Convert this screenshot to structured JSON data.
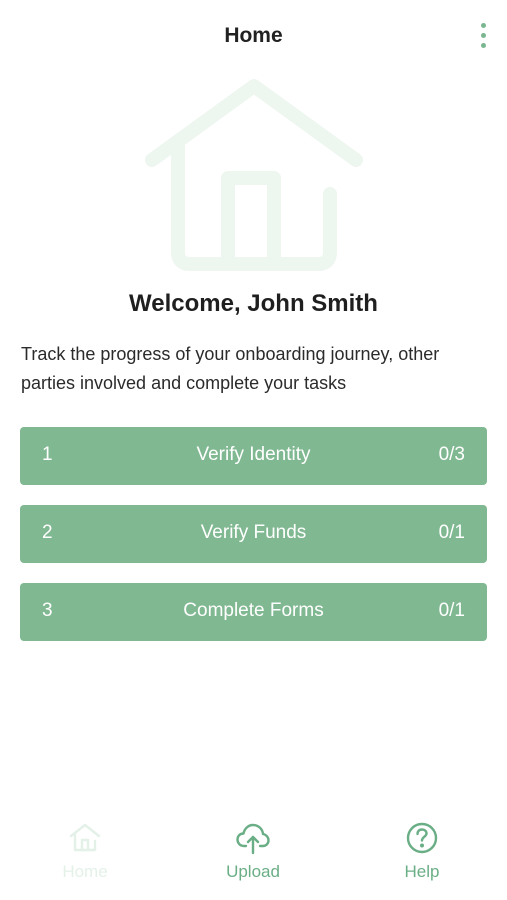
{
  "header": {
    "title": "Home",
    "menu_icon": "more-vert-icon"
  },
  "hero": {
    "icon": "house-icon"
  },
  "welcome": {
    "title": "Welcome, John Smith",
    "description": "Track the progress of your onboarding journey, other parties involved and complete your tasks"
  },
  "tasks": [
    {
      "number": "1",
      "label": "Verify Identity",
      "progress": "0/3"
    },
    {
      "number": "2",
      "label": "Verify Funds",
      "progress": "0/1"
    },
    {
      "number": "3",
      "label": "Complete Forms",
      "progress": "0/1"
    }
  ],
  "bottom_nav": {
    "items": [
      {
        "label": "Home",
        "icon": "home-icon",
        "active": false
      },
      {
        "label": "Upload",
        "icon": "cloud-upload-icon",
        "active": true
      },
      {
        "label": "Help",
        "icon": "help-circle-icon",
        "active": true
      }
    ]
  },
  "colors": {
    "accent": "#80b891",
    "icon_green": "#6aae86",
    "hero_tint": "#eef6f0"
  }
}
